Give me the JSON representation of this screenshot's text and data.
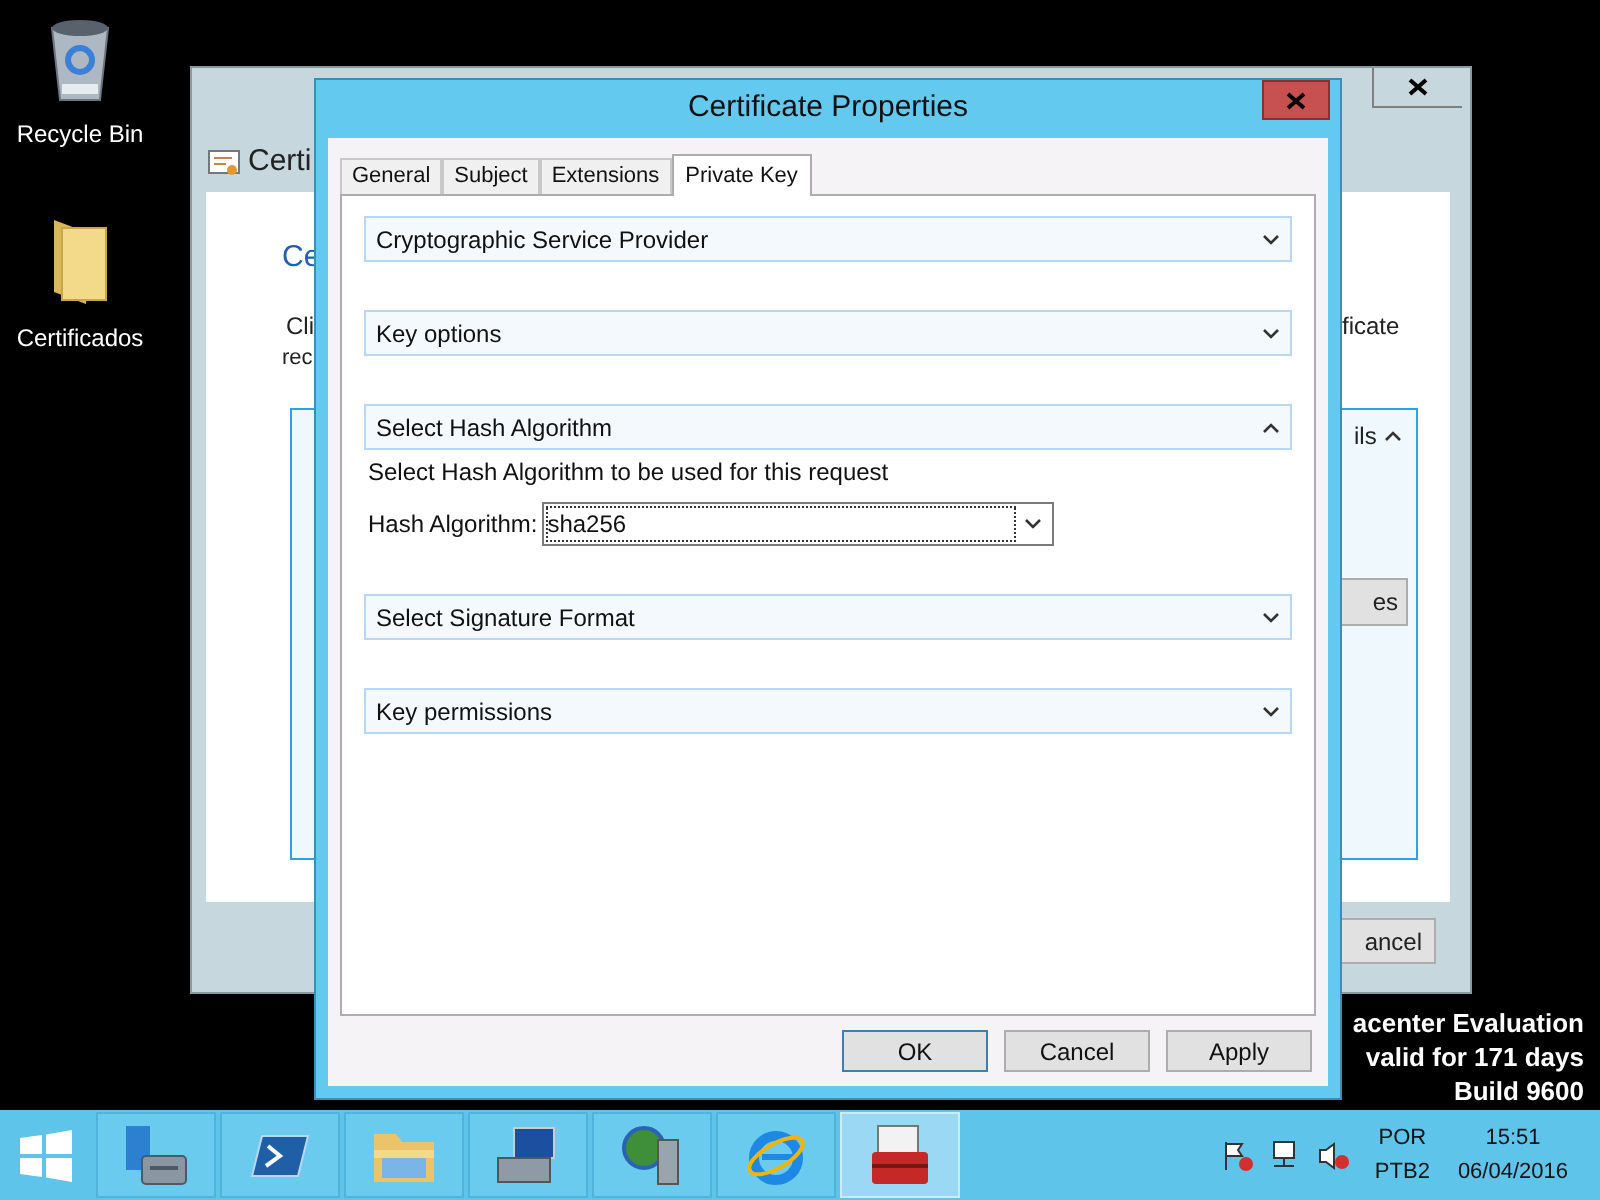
{
  "desktop_icons": [
    {
      "label": "Recycle Bin",
      "kind": "bin"
    },
    {
      "label": "Certificados",
      "kind": "folder"
    }
  ],
  "background_window": {
    "title": "Certi",
    "heading": "Ce",
    "text_left": [
      "Cli",
      "rec"
    ],
    "text_right": "ficate",
    "details_toggle": "ils",
    "button": "es",
    "cancel_button": "ancel"
  },
  "dialog": {
    "title": "Certificate Properties",
    "tabs": [
      {
        "label": "General",
        "selected": false
      },
      {
        "label": "Subject",
        "selected": false
      },
      {
        "label": "Extensions",
        "selected": false
      },
      {
        "label": "Private Key",
        "selected": true
      }
    ],
    "sections": [
      {
        "title": "Cryptographic Service Provider",
        "expanded": false
      },
      {
        "title": "Key options",
        "expanded": false
      },
      {
        "title": "Select Hash Algorithm",
        "expanded": true,
        "description": "Select Hash Algorithm to be used for this request",
        "field_label": "Hash Algorithm:",
        "value": "sha256"
      },
      {
        "title": "Select Signature Format",
        "expanded": false
      },
      {
        "title": "Key permissions",
        "expanded": false
      }
    ],
    "buttons": [
      "OK",
      "Cancel",
      "Apply"
    ]
  },
  "evaluation_lines": [
    "acenter Evaluation",
    "valid for 171 days",
    "Build 9600"
  ],
  "taskbar": {
    "apps": [
      {
        "kind": "server",
        "active": false
      },
      {
        "kind": "shell",
        "active": false
      },
      {
        "kind": "folder",
        "active": false
      },
      {
        "kind": "computer",
        "active": false
      },
      {
        "kind": "globe",
        "active": false
      },
      {
        "kind": "browser",
        "active": false
      },
      {
        "kind": "toolbox",
        "active": true
      }
    ],
    "language": "POR",
    "layout": "PTB2",
    "time": "15:51",
    "date": "06/04/2016"
  }
}
